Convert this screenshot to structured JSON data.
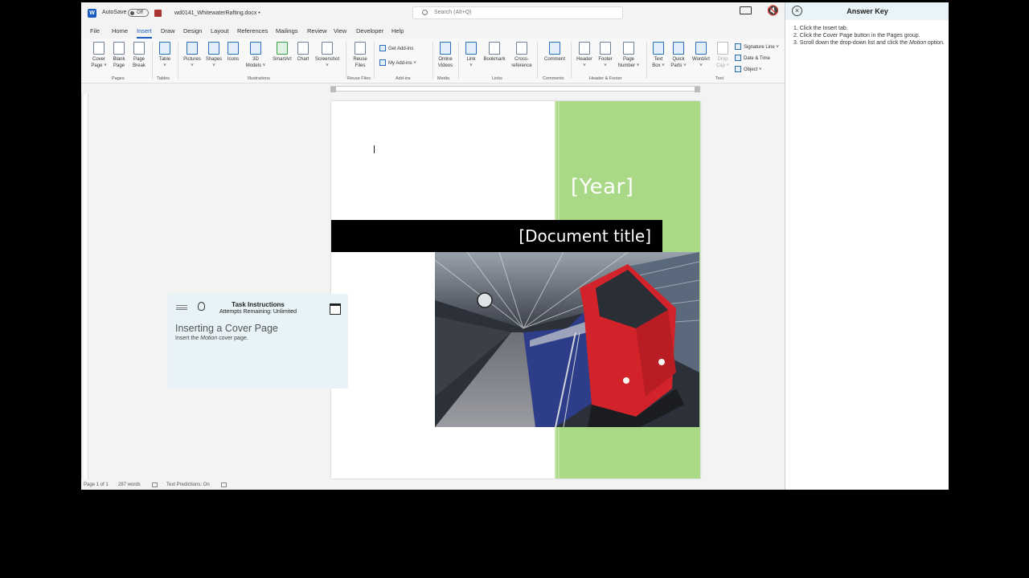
{
  "titlebar": {
    "app_icon": "word-icon",
    "autosave_label": "AutoSave",
    "autosave_state": "Off",
    "filename": "wd0141_WhitewaterRafting.docx",
    "filename_chevron": "•",
    "search_placeholder": "Search (Alt+Q)"
  },
  "tabs": [
    "File",
    "Home",
    "Insert",
    "Draw",
    "Design",
    "Layout",
    "References",
    "Mailings",
    "Review",
    "View",
    "Developer",
    "Help"
  ],
  "active_tab": "Insert",
  "ribbon": {
    "buttons": {
      "cover": "Cover",
      "cover2": "Page ˅",
      "blank": "Blank",
      "blank2": "Page",
      "break": "Page",
      "break2": "Break",
      "table": "Table",
      "table2": "˅",
      "pictures": "Pictures",
      "pictures2": "˅",
      "shapes": "Shapes",
      "shapes2": "˅",
      "icons": "Icons",
      "models": "3D",
      "models2": "Models ˅",
      "smartart": "SmartArt",
      "chart": "Chart",
      "screenshot": "Screenshot",
      "screenshot2": "˅",
      "reuse": "Reuse",
      "reuse2": "Files",
      "getaddins": "Get Add-ins",
      "myaddins": "My Add-ins ˅",
      "online": "Online",
      "online2": "Videos",
      "link": "Link",
      "link2": "˅",
      "bookmark": "Bookmark",
      "cross": "Cross-",
      "cross2": "reference",
      "comment": "Comment",
      "header": "Header",
      "header2": "˅",
      "footer": "Footer",
      "footer2": "˅",
      "pagenum": "Page",
      "pagenum2": "Number ˅",
      "textbox": "Text",
      "textbox2": "Box ˅",
      "quick": "Quick",
      "quick2": "Parts ˅",
      "wordart": "WordArt",
      "wordart2": "˅",
      "dropcap": "Drop",
      "dropcap2": "Cap ˅",
      "sigline": "Signature Line ˅",
      "datetime": "Date & Time",
      "object": "Object ˅"
    },
    "groups": {
      "pages": "Pages",
      "tables": "Tables",
      "illustrations": "Illustrations",
      "reuse": "Reuse Files",
      "addins": "Add-ins",
      "media": "Media",
      "links": "Links",
      "comments": "Comments",
      "headerfooter": "Header & Footer",
      "text": "Text"
    }
  },
  "document": {
    "year_placeholder": "[Year]",
    "title_placeholder": "[Document title]",
    "green_color": "#a9d887",
    "image": "train-at-station-photo"
  },
  "task": {
    "title": "Task Instructions",
    "attempts": "Attempts Remaining: Unlimited",
    "heading": "Inserting a Cover Page",
    "desc_pre": "Insert the ",
    "desc_em": "Motion",
    "desc_post": " cover page."
  },
  "status": {
    "page": "Page 1 of 1",
    "words": "287 words",
    "predictions": "Text Predictions: On"
  },
  "answer_key": {
    "title": "Answer Key",
    "step1": "1. Click the Insert tab.",
    "step2": "2. Click the Cover Page button in the Pages group.",
    "step3_pre": "3. Scroll down the drop-down list and click the ",
    "step3_em": "Motion",
    "step3_post": " option."
  }
}
